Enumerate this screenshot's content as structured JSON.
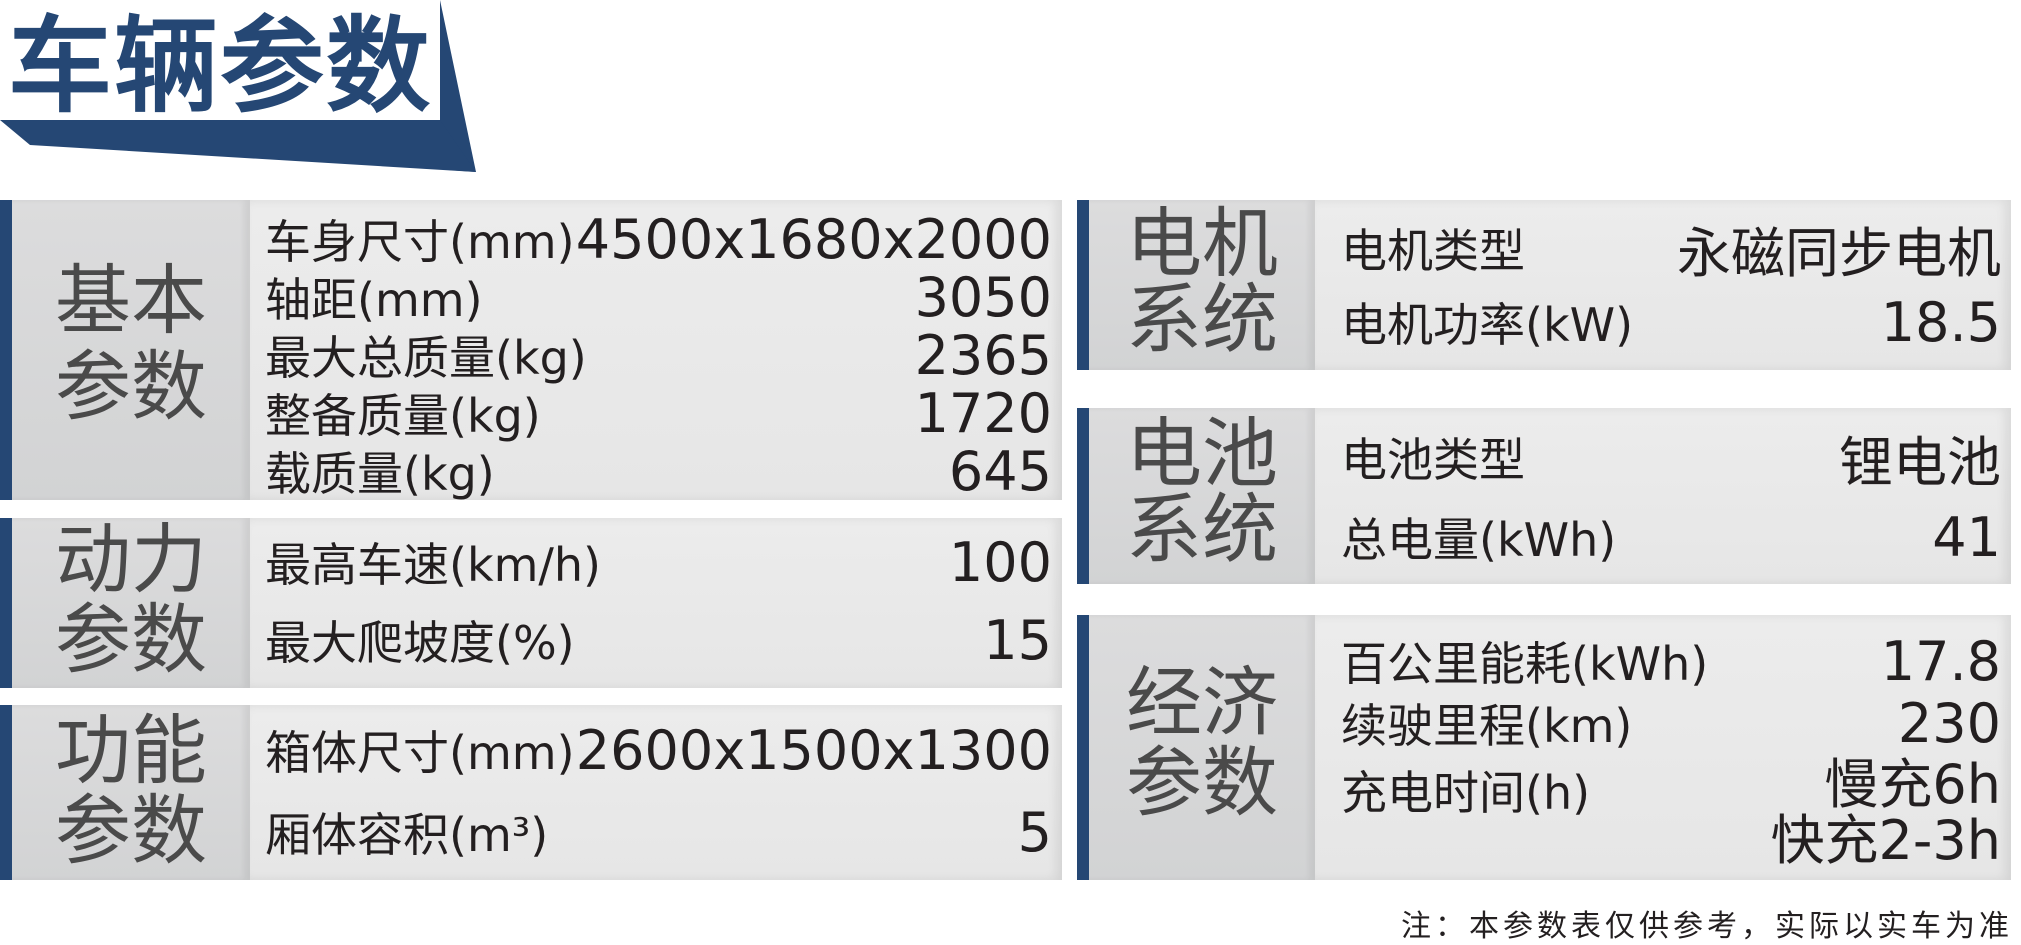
{
  "header": {
    "title": "车辆参数"
  },
  "colors": {
    "accent": "#254774",
    "panel_light": "#ececec",
    "panel_dark": "#d6d7d8"
  },
  "sections": {
    "basic": {
      "category": [
        "基本",
        "参数"
      ],
      "rows": [
        {
          "label": "车身尺寸(mm)",
          "value": "4500x1680x2000"
        },
        {
          "label": "轴距(mm)",
          "value": "3050"
        },
        {
          "label": "最大总质量(kg)",
          "value": "2365"
        },
        {
          "label": "整备质量(kg)",
          "value": "1720"
        },
        {
          "label": "载质量(kg)",
          "value": "645"
        }
      ]
    },
    "power": {
      "category": [
        "动力",
        "参数"
      ],
      "rows": [
        {
          "label": "最高车速(km/h)",
          "value": "100"
        },
        {
          "label": "最大爬坡度(%)",
          "value": "15"
        }
      ]
    },
    "function": {
      "category": [
        "功能",
        "参数"
      ],
      "rows": [
        {
          "label": "箱体尺寸(mm)",
          "value": "2600x1500x1300"
        },
        {
          "label": "厢体容积(m³)",
          "value": "5"
        }
      ]
    },
    "motor": {
      "category": [
        "电机",
        "系统"
      ],
      "rows": [
        {
          "label": "电机类型",
          "value": "永磁同步电机"
        },
        {
          "label": "电机功率(kW)",
          "value": "18.5"
        }
      ]
    },
    "battery": {
      "category": [
        "电池",
        "系统"
      ],
      "rows": [
        {
          "label": "电池类型",
          "value": "锂电池"
        },
        {
          "label": "总电量(kWh)",
          "value": "41"
        }
      ]
    },
    "economy": {
      "category": [
        "经济",
        "参数"
      ],
      "rows": [
        {
          "label": "百公里能耗(kWh)",
          "value": "17.8"
        },
        {
          "label": "续驶里程(km)",
          "value": "230"
        },
        {
          "label": "充电时间(h)",
          "value_lines": [
            "慢充6h",
            "快充2-3h"
          ]
        }
      ]
    }
  },
  "footer": {
    "note": "注：本参数表仅供参考，实际以实车为准"
  }
}
